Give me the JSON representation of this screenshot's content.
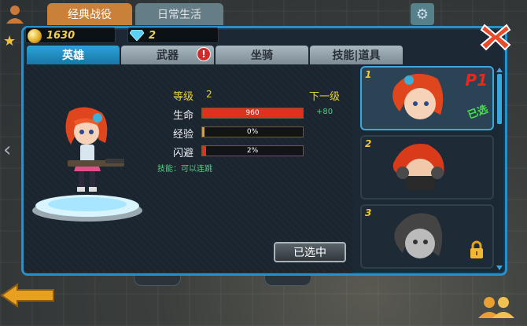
{
  "top_tabs": {
    "campaign": "经典战役",
    "daily": "日常生活"
  },
  "resources": {
    "gold": "1630",
    "gems": "2"
  },
  "tabs": [
    {
      "label": "英雄",
      "active": true,
      "alert": false
    },
    {
      "label": "武器",
      "active": false,
      "alert": true
    },
    {
      "label": "坐骑",
      "active": false,
      "alert": false
    },
    {
      "label": "技能|道具",
      "active": false,
      "alert": false
    }
  ],
  "alert_mark": "!",
  "hero": {
    "level_label": "等级",
    "level_value": "2",
    "next_label": "下一级",
    "next_bonus": "+80",
    "stats": [
      {
        "label": "生命",
        "text": "960",
        "fraction": 1.0,
        "color": "#e0301e"
      },
      {
        "label": "经验",
        "text": "0%",
        "fraction": 0.02,
        "color": "#e0a020"
      },
      {
        "label": "闪避",
        "text": "2%",
        "fraction": 0.04,
        "color": "#e0301e"
      }
    ],
    "skill": "技能：可以连跳",
    "select_button": "已选中"
  },
  "slots": [
    {
      "num": "1",
      "tag": "P1",
      "status": "已选",
      "selected": true,
      "locked": false
    },
    {
      "num": "2",
      "tag": "",
      "status": "",
      "selected": false,
      "locked": false
    },
    {
      "num": "3",
      "tag": "",
      "status": "",
      "selected": false,
      "locked": true
    }
  ],
  "colors": {
    "accent": "#2ca3d6",
    "gold": "#f2c83a",
    "red": "#e62a1a",
    "green": "#47e04a"
  }
}
